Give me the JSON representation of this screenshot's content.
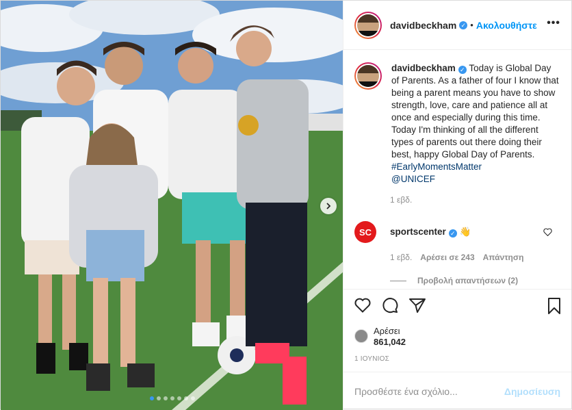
{
  "header": {
    "username": "davidbeckham",
    "separator": "•",
    "follow_label": "Ακολουθήστε",
    "more_label": "•••"
  },
  "caption": {
    "username": "davidbeckham",
    "text": "Today is Global Day of Parents. As a father of four I know that being a parent means you have to show strength, love, care and patience all at once and especially during this time. Today I'm thinking of all the different types of parents out there doing their best, happy Global Day of Parents. ",
    "hashtag": "#EarlyMomentsMatter",
    "mention": "@UNICEF",
    "time": "1 εβδ."
  },
  "comment": {
    "username": "sportscenter",
    "logo_text": "SC",
    "emoji": "👋",
    "time": "1 εβδ.",
    "likes": "Αρέσει σε 243",
    "reply": "Απάντηση",
    "view_replies": "Προβολή απαντήσεων (2)"
  },
  "likes": {
    "label": "Αρέσει",
    "count": "861,042"
  },
  "date": "1 ΙΟΥΝΙΟΣ",
  "add_comment": {
    "placeholder": "Προσθέστε ένα σχόλιο...",
    "post_label": "Δημοσίευση"
  },
  "carousel": {
    "total": 7,
    "active_index": 0
  },
  "colors": {
    "accent": "#0095f6",
    "verified": "#3897f0",
    "post_disabled": "#b2dffc",
    "muted": "#8e8e8e",
    "sportscenter_red": "#e31a1c"
  }
}
